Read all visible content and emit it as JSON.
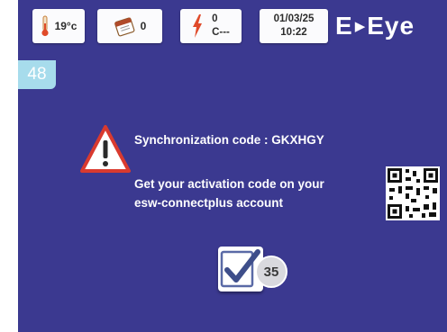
{
  "status_bar": {
    "temperature": "19°c",
    "calendar_count": "0",
    "power_value": "0",
    "power_unit": "C---",
    "date": "01/03/25",
    "time": "10:22"
  },
  "brand": {
    "left": "E",
    "right": "Eye"
  },
  "page_number": "48",
  "message": {
    "sync_line": "Synchronization code : GKXHGY",
    "hint_line1": "Get your activation code on your",
    "hint_line2": "esw-connectplus account"
  },
  "confirm": {
    "countdown": "35"
  },
  "colors": {
    "background": "#3b3990",
    "badge": "#a7dcec",
    "warning": "#d93a2f"
  }
}
